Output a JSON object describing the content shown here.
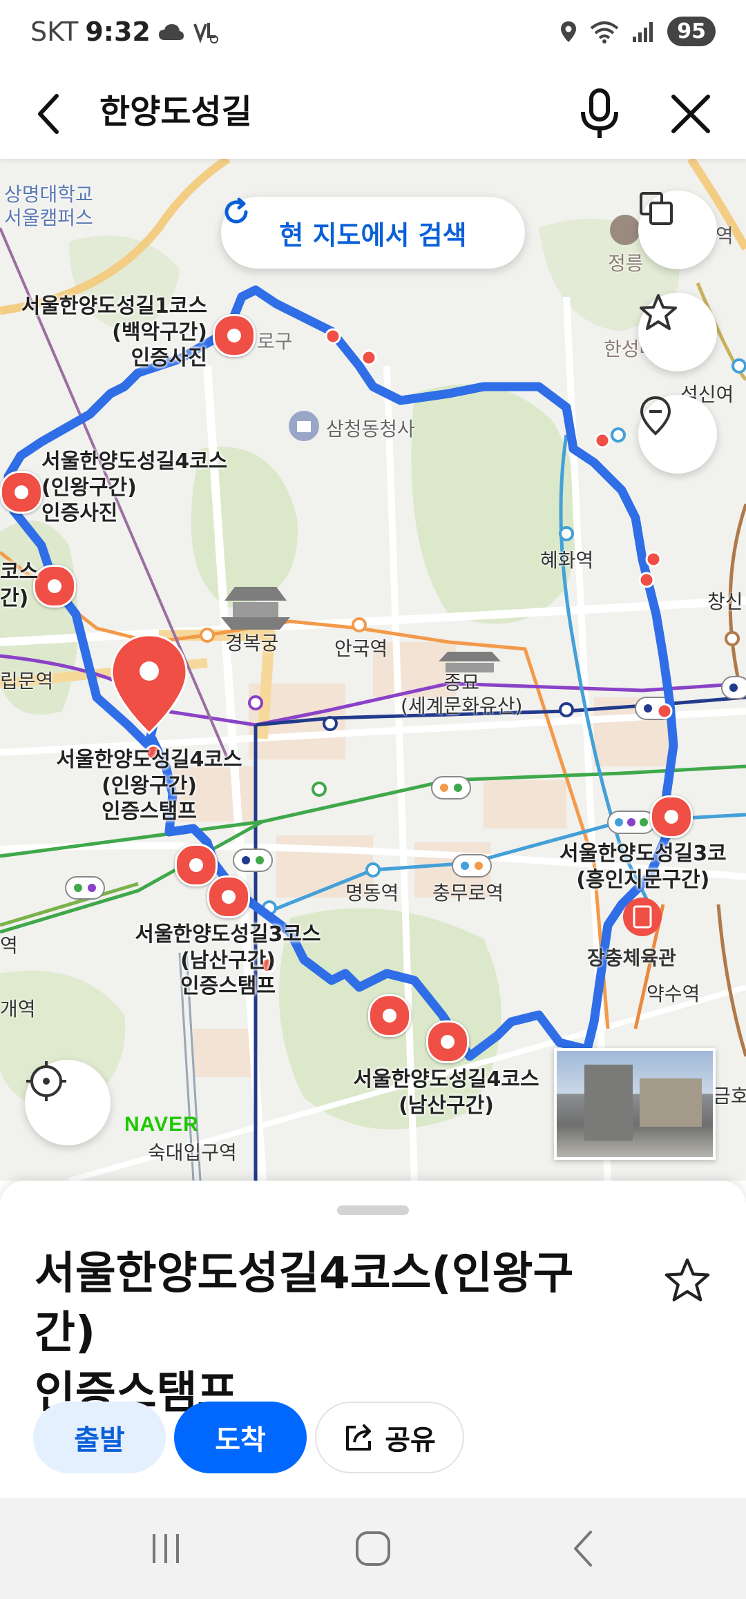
{
  "status_bar": {
    "carrier": "SKT",
    "time": "9:32",
    "battery": "95"
  },
  "search_bar": {
    "query": "한양도성길"
  },
  "map": {
    "research_label": "현 지도에서 검색",
    "place_labels": {
      "univ": "상명대학교\n서울캠퍼스",
      "samcheong": "삼청동청사",
      "jeongneung": "정릉",
      "hansung": "한성대입구",
      "seoksin": "석신여",
      "hyehwa": "혜화역",
      "changsin": "창신",
      "gyeongbokgung": "경복궁",
      "anguk": "안국역",
      "jongmyo": "종묘\n(세계문화유산)",
      "rimmun": "립문역",
      "myeongdong": "명동역",
      "chungmuro": "충무로역",
      "jangchung": "장충체육관",
      "yaksu": "약수역",
      "gaeyeok": "개역",
      "station_left": "역",
      "sookmyung": "숙대입구역",
      "geumho": "금호",
      "jongno_gu": "로구",
      "seokbuk": "역"
    },
    "pin_labels": [
      "서울한양도성길1코스\n(백악구간)\n인증사진",
      "서울한양도성길4코스\n(인왕구간)\n인증사진",
      "코스\n간)",
      "서울한양도성길4코스\n(인왕구간)\n인증스탬프",
      "서울한양도성길3코스\n(남산구간)\n인증스탬프",
      "서울한양도성길4코스\n(남산구간)",
      "서울한양도성길3코\n(흥인지문구간)"
    ],
    "naver_logo": "NAVER"
  },
  "sheet": {
    "title": "서울한양도성길4코스(인왕구간)\n인증스탬프",
    "buttons": {
      "depart": "출발",
      "arrive": "도착",
      "share": "공유"
    }
  },
  "colors": {
    "primary": "#0068ff",
    "route": "#2f6ee6",
    "marker": "#ef4f45",
    "light_blue": "#e5f0ff"
  }
}
